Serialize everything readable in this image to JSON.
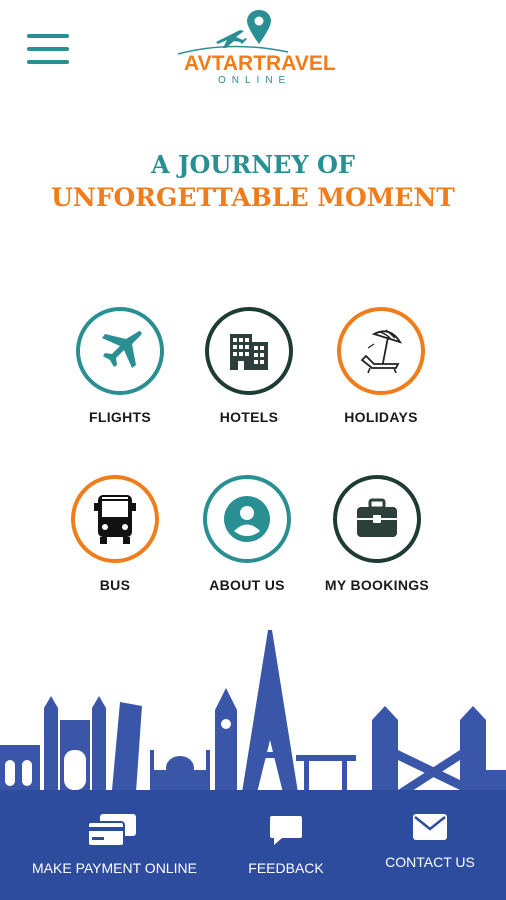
{
  "header": {
    "menu_icon": "hamburger-icon",
    "logo_text": "AVTARTRAVEL",
    "logo_sub": "ONLINE"
  },
  "headline": {
    "line1": "A JOURNEY OF",
    "line2": "UNFORGETTABLE MOMENT"
  },
  "colors": {
    "teal": "#2a8f92",
    "orange": "#f07d1c",
    "dark": "#1f3b35",
    "footer_blue": "#2e4c9e"
  },
  "menu_tiles": [
    {
      "label": "FLIGHTS",
      "icon": "plane-icon"
    },
    {
      "label": "HOTELS",
      "icon": "building-icon"
    },
    {
      "label": "HOLIDAYS",
      "icon": "beach-umbrella-icon"
    },
    {
      "label": "BUS",
      "icon": "bus-icon"
    },
    {
      "label": "ABOUT US",
      "icon": "user-icon"
    },
    {
      "label": "MY BOOKINGS",
      "icon": "briefcase-icon"
    }
  ],
  "footer": [
    {
      "label": "MAKE PAYMENT ONLINE",
      "icon": "credit-cards-icon"
    },
    {
      "label": "FEEDBACK",
      "icon": "chat-bubble-icon"
    },
    {
      "label": "CONTACT US",
      "icon": "envelope-icon"
    }
  ]
}
